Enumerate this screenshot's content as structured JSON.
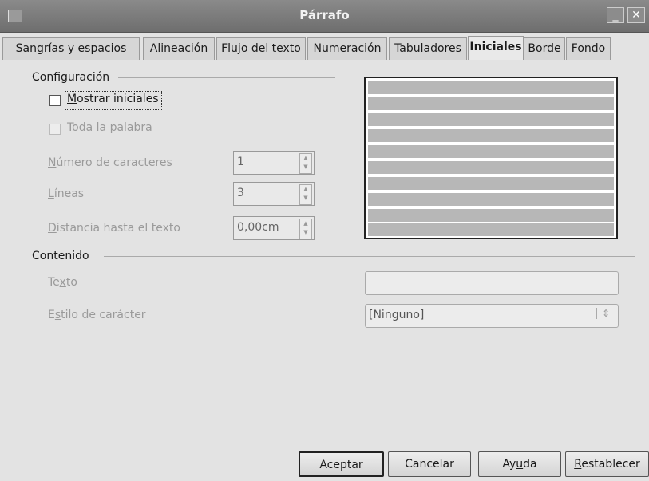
{
  "window": {
    "title": "Párrafo",
    "minimize_glyph": "_",
    "close_glyph": "✕"
  },
  "tabs": [
    {
      "label": "Sangrías y espacios"
    },
    {
      "label": "Alineación"
    },
    {
      "label": "Flujo del texto"
    },
    {
      "label": "Numeración"
    },
    {
      "label": "Tabuladores"
    },
    {
      "label": "Iniciales"
    },
    {
      "label": "Borde"
    },
    {
      "label": "Fondo"
    }
  ],
  "active_tab": "Iniciales",
  "configuracion": {
    "heading": "Configuración",
    "mostrar_iniciales": {
      "label_pre": "",
      "mnemonic": "M",
      "label_post": "ostrar iniciales",
      "checked": false
    },
    "toda_palabra": {
      "label_pre": "Toda la pala",
      "mnemonic": "b",
      "label_post": "ra",
      "checked": false,
      "disabled": true
    },
    "numero_caracteres": {
      "label_pre": "",
      "mnemonic": "N",
      "label_post": "úmero de caracteres",
      "value": "1"
    },
    "lineas": {
      "label_pre": "",
      "mnemonic": "L",
      "label_post": "íneas",
      "value": "3"
    },
    "distancia": {
      "label_pre": "",
      "mnemonic": "D",
      "label_post": "istancia hasta el texto",
      "value": "0,00cm"
    }
  },
  "contenido": {
    "heading": "Contenido",
    "texto": {
      "label_pre": "Te",
      "mnemonic": "x",
      "label_post": "to",
      "value": ""
    },
    "estilo": {
      "label_pre": "E",
      "mnemonic": "s",
      "label_post": "tilo de carácter",
      "value": "[Ninguno]"
    }
  },
  "buttons": {
    "aceptar": "Aceptar",
    "cancelar": "Cancelar",
    "ayuda": {
      "pre": "Ay",
      "mnemonic": "u",
      "post": "da"
    },
    "restablecer": {
      "pre": "",
      "mnemonic": "R",
      "post": "establecer"
    }
  }
}
